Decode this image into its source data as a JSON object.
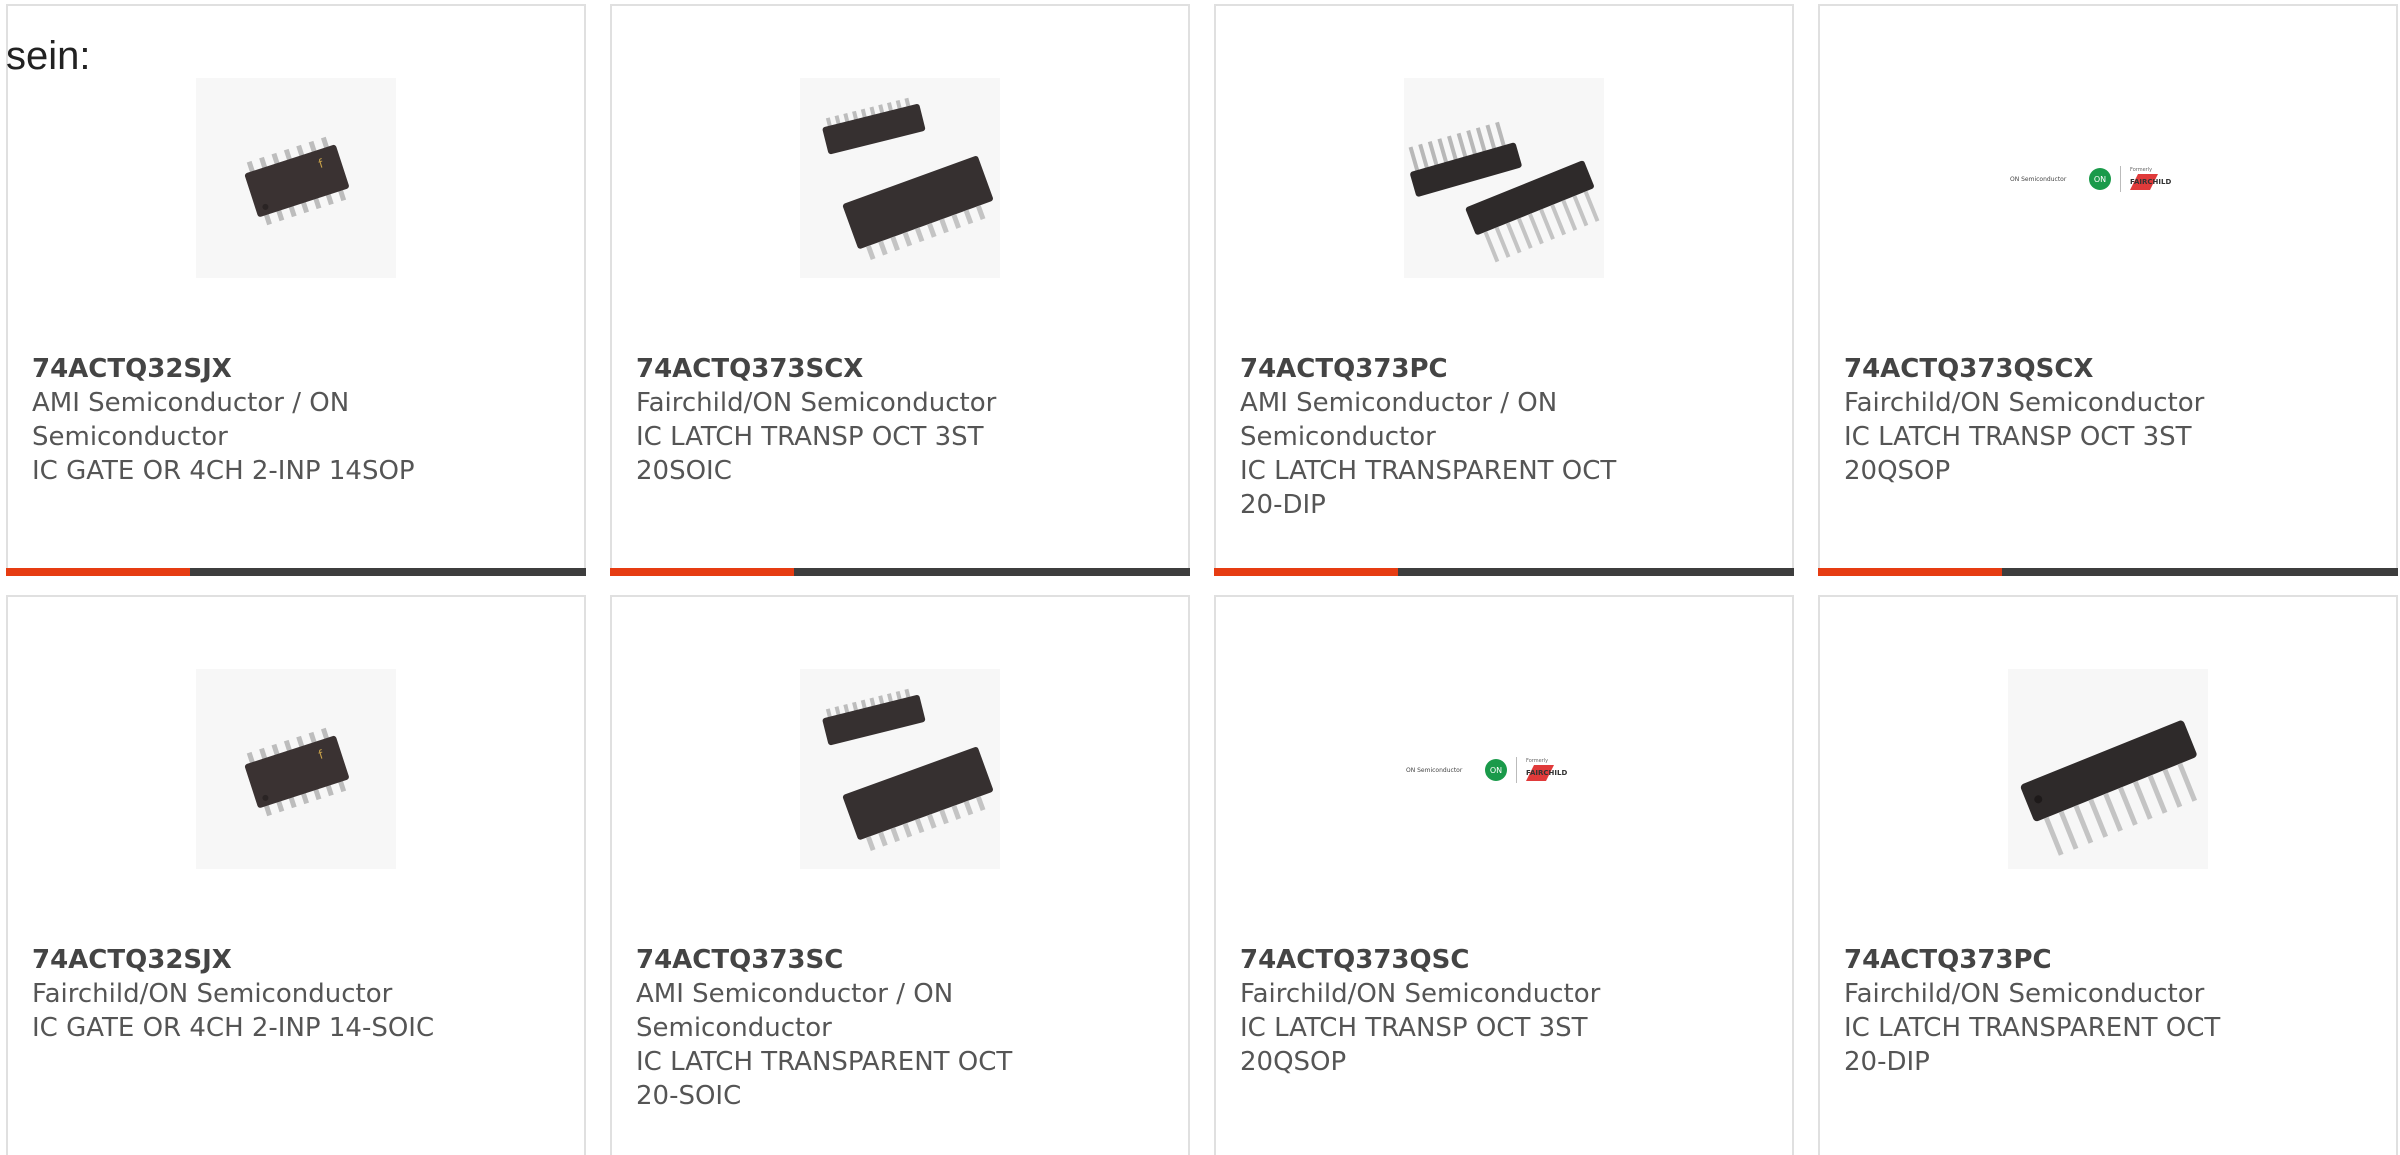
{
  "intro_text": "sein:",
  "colors": {
    "accent": "#e63c12",
    "bar": "#3d3d3d",
    "border": "#e0e0e0",
    "text": "#555555"
  },
  "products": [
    {
      "part_number": "74ACTQ32SJX",
      "manufacturer": "AMI Semiconductor / ON Semiconductor",
      "description": "IC GATE OR 4CH 2-INP 14SOP",
      "image_icon": "soic-14-chip-icon"
    },
    {
      "part_number": "74ACTQ373SCX",
      "manufacturer": "Fairchild/ON Semiconductor",
      "description": "IC LATCH TRANSP OCT 3ST 20SOIC",
      "image_icon": "soic-20-chip-icon"
    },
    {
      "part_number": "74ACTQ373PC",
      "manufacturer": "AMI Semiconductor / ON Semiconductor",
      "description": "IC LATCH TRANSPARENT OCT 20-DIP",
      "image_icon": "dip-20-chip-icon"
    },
    {
      "part_number": "74ACTQ373QSCX",
      "manufacturer": "Fairchild/ON Semiconductor",
      "description": "IC LATCH TRANSP OCT 3ST 20QSOP",
      "image_icon": "on-semi-fairchild-logo",
      "logo": {
        "left": "ON Semiconductor",
        "badge": "ON",
        "formerly": "Formerly",
        "right": "FAIRCHILD"
      }
    },
    {
      "part_number": "74ACTQ32SJX",
      "manufacturer": "Fairchild/ON Semiconductor",
      "description": "IC GATE OR 4CH 2-INP 14-SOIC",
      "image_icon": "soic-14-chip-icon"
    },
    {
      "part_number": "74ACTQ373SC",
      "manufacturer": "AMI Semiconductor / ON Semiconductor",
      "description": "IC LATCH TRANSPARENT OCT 20-SOIC",
      "image_icon": "soic-20-chip-icon"
    },
    {
      "part_number": "74ACTQ373QSC",
      "manufacturer": "Fairchild/ON Semiconductor",
      "description": "IC LATCH TRANSP OCT 3ST 20QSOP",
      "image_icon": "on-semi-fairchild-logo",
      "logo": {
        "left": "ON Semiconductor",
        "badge": "ON",
        "formerly": "Formerly",
        "right": "FAIRCHILD"
      }
    },
    {
      "part_number": "74ACTQ373PC",
      "manufacturer": "Fairchild/ON Semiconductor",
      "description": "IC LATCH TRANSPARENT OCT 20-DIP",
      "image_icon": "dip-20-single-chip-icon"
    }
  ]
}
